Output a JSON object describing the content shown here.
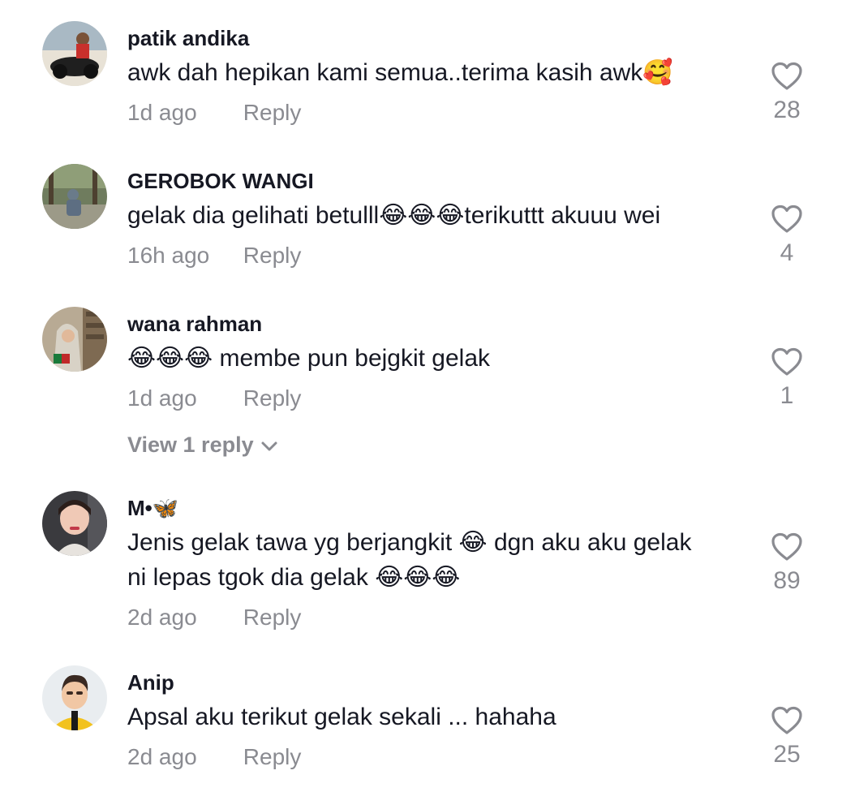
{
  "comments": [
    {
      "username": "patik andika",
      "text": "awk dah hepikan kami semua..terima kasih awk🥰",
      "time": "1d ago",
      "reply_label": "Reply",
      "likes": "28"
    },
    {
      "username": "GEROBOK WANGI",
      "text": "gelak dia gelihati betulll😂😂😂terikuttt akuuu wei",
      "time": "16h ago",
      "reply_label": "Reply",
      "likes": "4"
    },
    {
      "username": "wana rahman",
      "text": "😂😂😂 membe pun bejgkit gelak",
      "time": "1d ago",
      "reply_label": "Reply",
      "likes": "1",
      "view_replies": "View 1 reply"
    },
    {
      "username": "M•🦋",
      "text": "Jenis gelak tawa yg berjangkit 😂 dgn aku aku gelak ni lepas tgok dia gelak 😂😂😂",
      "time": "2d ago",
      "reply_label": "Reply",
      "likes": "89"
    },
    {
      "username": "Anip",
      "text": "Apsal aku terikut gelak sekali ... hahaha",
      "time": "2d ago",
      "reply_label": "Reply",
      "likes": "25"
    }
  ],
  "icons": {
    "like": "heart-outline-icon",
    "expand": "chevron-down-icon"
  },
  "colors": {
    "text_primary": "#161823",
    "text_secondary": "#8a8b91",
    "background": "#ffffff"
  }
}
